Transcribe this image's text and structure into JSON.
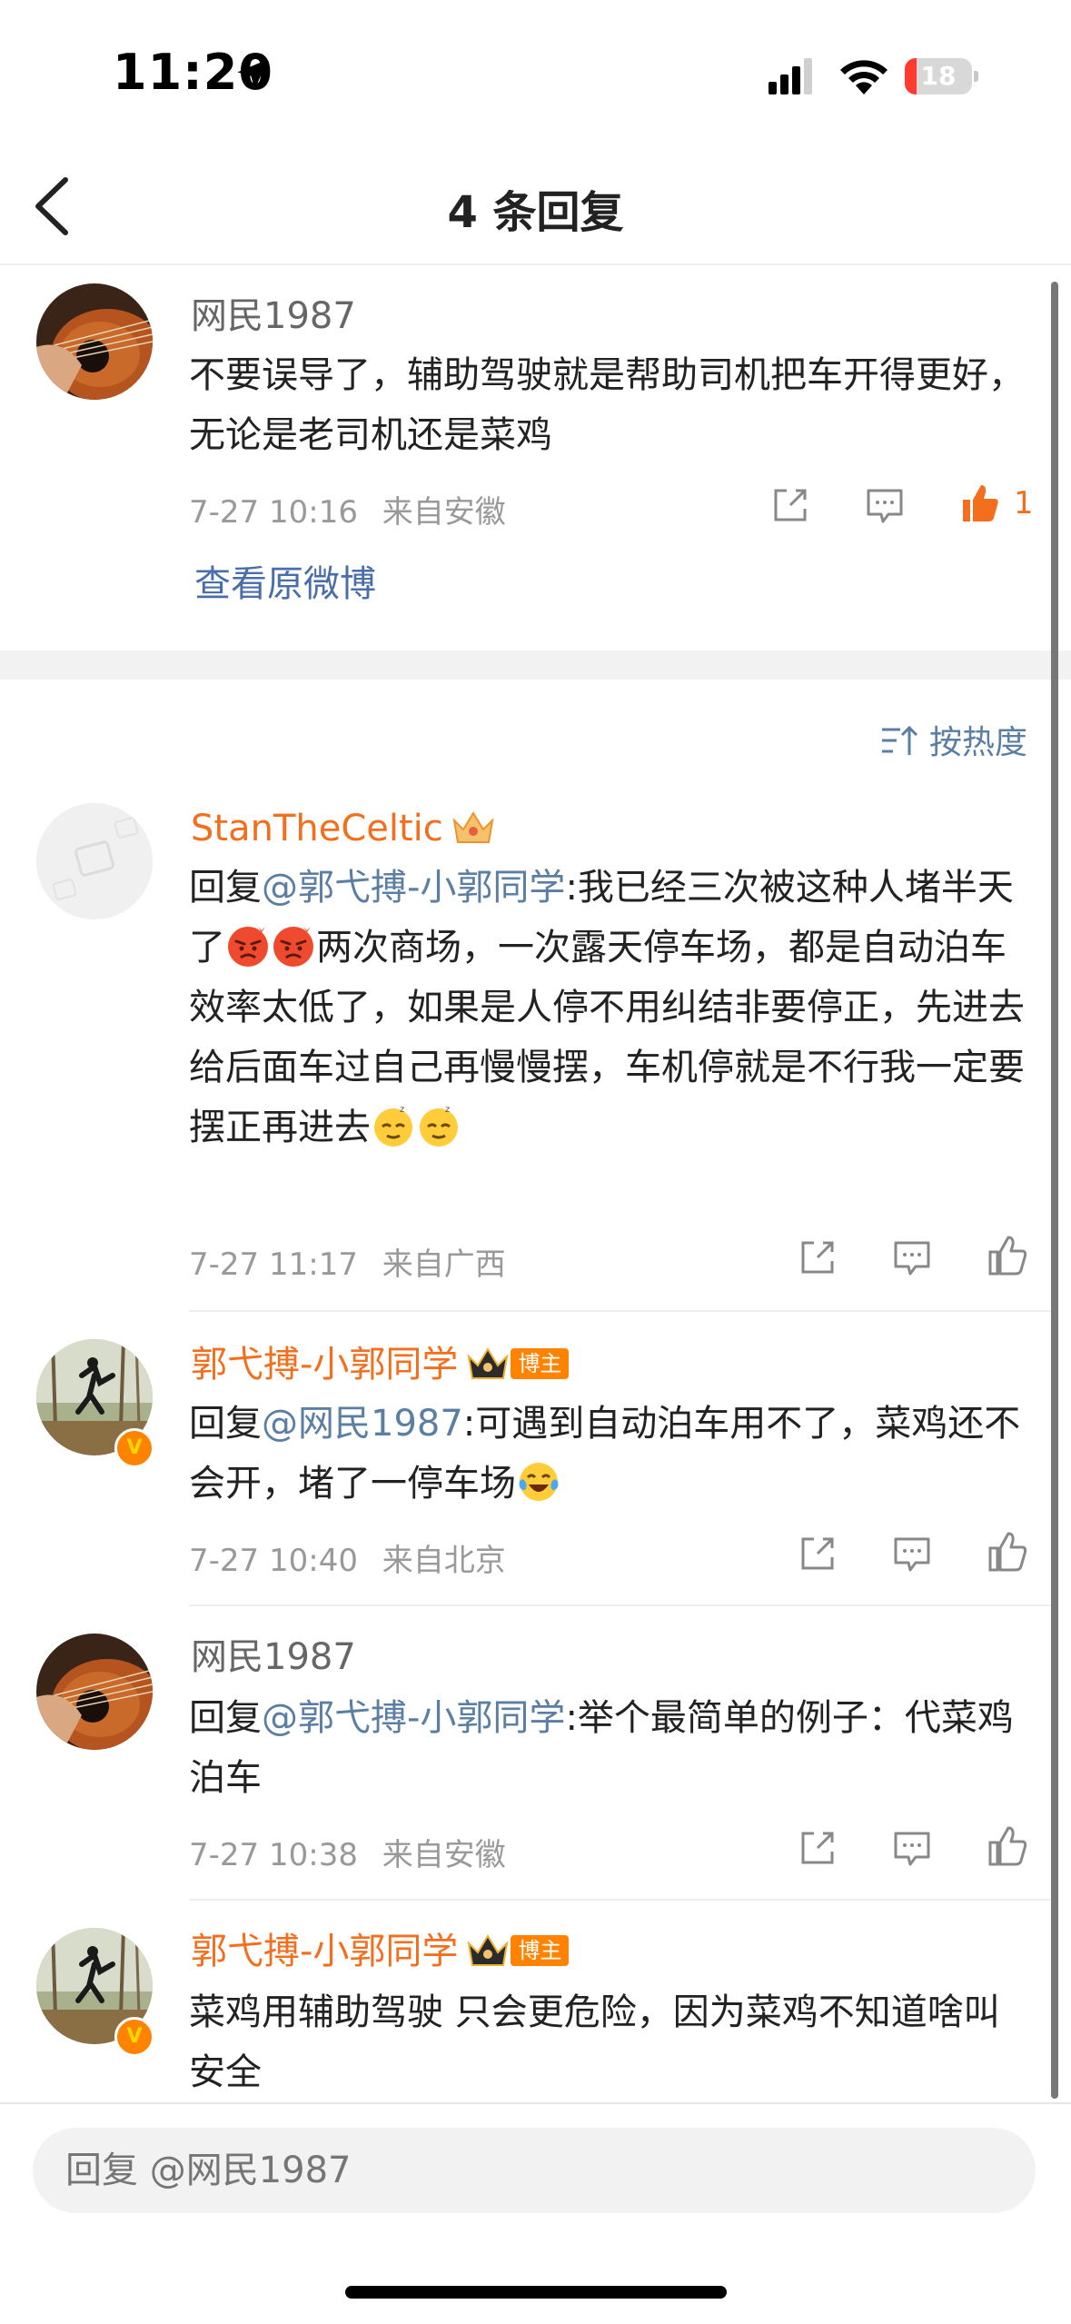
{
  "status_bar": {
    "time": "11:20",
    "battery": "18",
    "battery_fraction": 0.18
  },
  "nav": {
    "title": "4 条回复"
  },
  "root_comment": {
    "user": "网民1987",
    "text": "不要误导了，辅助驾驶就是帮助司机把车开得更好，无论是老司机还是菜鸡",
    "time": "7-27 10:16",
    "location": "来自安徽",
    "likes": "1",
    "view_original": "查看原微博"
  },
  "sort": {
    "label": "按热度"
  },
  "replies": [
    {
      "user": "StanTheCeltic",
      "reply_prefix": "回复",
      "mention": "@郭弋搏-小郭同学",
      "text_1": ":我已经三次被这种人堵半天了",
      "text_2": "两次商场，一次露天停车场，都是自动泊车效率太低了，如果是人停不用纠结非要停正，先进去给后面车过自己再慢慢摆，车机停就是不行我一定要摆正再进去",
      "time": "7-27 11:17",
      "location": "来自广西"
    },
    {
      "user": "郭弋搏-小郭同学",
      "tag": "博主",
      "reply_prefix": "回复",
      "mention": "@网民1987",
      "text_1": ":可遇到自动泊车用不了，菜鸡还不会开，堵了一停车场",
      "time": "7-27 10:40",
      "location": "来自北京"
    },
    {
      "user": "网民1987",
      "reply_prefix": "回复",
      "mention": "@郭弋搏-小郭同学",
      "text_1": ":举个最简单的例子：代菜鸡泊车",
      "time": "7-27 10:38",
      "location": "来自安徽"
    },
    {
      "user": "郭弋搏-小郭同学",
      "tag": "博主",
      "text_1": "菜鸡用辅助驾驶 只会更危险，因为菜鸡不知道啥叫安全"
    }
  ],
  "reply_bar": {
    "placeholder": "回复 @网民1987"
  },
  "colors": {
    "accent_orange": "#f36f1e",
    "link_blue": "#5b7ea3",
    "meta_gray": "#999999",
    "battery_red": "#ff3b30"
  },
  "icons": [
    "location-arrow-icon",
    "signal-icon",
    "wifi-icon",
    "battery-icon",
    "back-chevron-icon",
    "share-icon",
    "comment-icon",
    "like-icon",
    "sort-icon",
    "crown-icon",
    "verified-badge-icon",
    "angry-face-emoji",
    "sleepy-face-emoji",
    "laughing-tears-emoji"
  ]
}
